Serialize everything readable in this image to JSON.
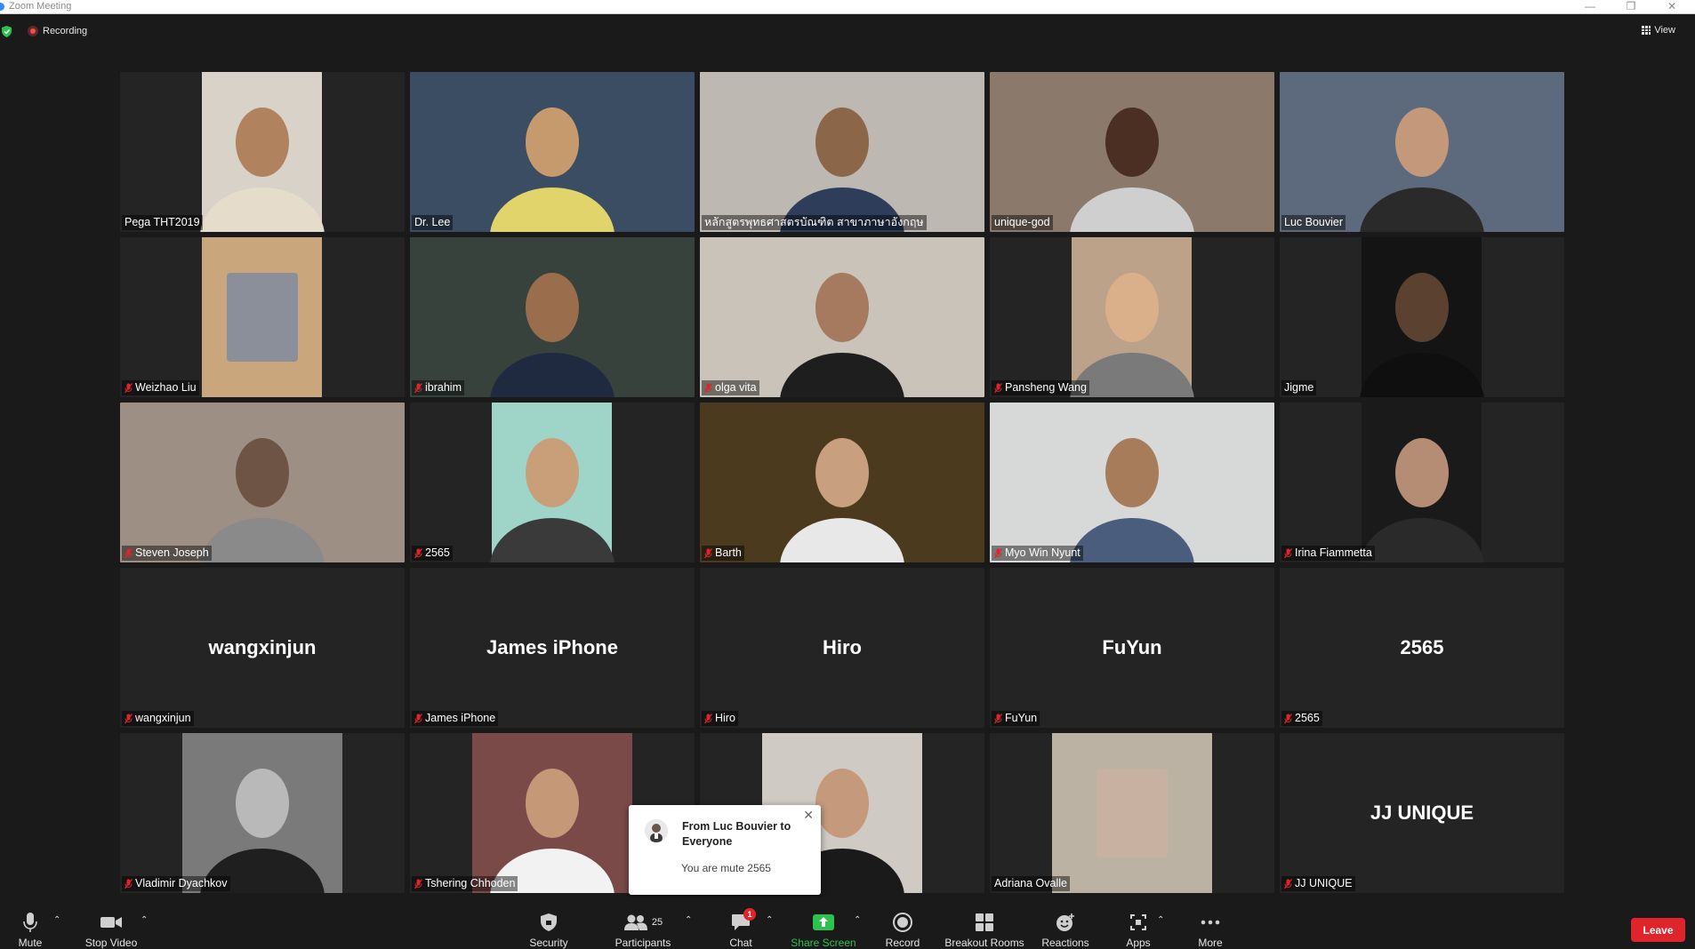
{
  "window": {
    "title": "Zoom Meeting"
  },
  "header": {
    "recording_label": "Recording",
    "view_label": "View"
  },
  "tiles": [
    {
      "name": "Pega THT2019",
      "muted": false
    },
    {
      "name": "Dr. Lee",
      "muted": false
    },
    {
      "name": "หลักสูตรพุทธศาสตรบัณฑิต สาขาภาษาอังกฤษ",
      "muted": false,
      "speaking": true
    },
    {
      "name": "unique-god",
      "muted": false
    },
    {
      "name": "Luc Bouvier",
      "muted": false
    },
    {
      "name": "Weizhao Liu",
      "muted": true
    },
    {
      "name": "ibrahim",
      "muted": true
    },
    {
      "name": "olga vita",
      "muted": true
    },
    {
      "name": "Pansheng Wang",
      "muted": true
    },
    {
      "name": "Jigme",
      "muted": false
    },
    {
      "name": "Steven Joseph",
      "muted": true
    },
    {
      "name": "2565",
      "muted": true
    },
    {
      "name": "Barth",
      "muted": true
    },
    {
      "name": "Myo Win Nyunt",
      "muted": true
    },
    {
      "name": "Irina Fiammetta",
      "muted": true
    },
    {
      "name": "wangxinjun",
      "muted": true,
      "center_name": "wangxinjun"
    },
    {
      "name": "James iPhone",
      "muted": true,
      "center_name": "James iPhone"
    },
    {
      "name": "Hiro",
      "muted": true,
      "center_name": "Hiro"
    },
    {
      "name": "FuYun",
      "muted": true,
      "center_name": "FuYun"
    },
    {
      "name": "2565",
      "muted": true,
      "center_name": "2565"
    },
    {
      "name": "Vladimir Dyachkov",
      "muted": true
    },
    {
      "name": "Tshering Chhoden",
      "muted": true
    },
    {
      "name": "",
      "muted": false
    },
    {
      "name": "Adriana Ovalle",
      "muted": false
    },
    {
      "name": "JJ UNIQUE",
      "muted": true,
      "center_name": "JJ UNIQUE"
    }
  ],
  "chat_popup": {
    "from": "From Luc Bouvier to Everyone",
    "message": "You are mute 2565"
  },
  "toolbar": {
    "mute": "Mute",
    "stop_video": "Stop Video",
    "security": "Security",
    "participants": "Participants",
    "participant_count": "25",
    "chat": "Chat",
    "chat_badge": "1",
    "share_screen": "Share Screen",
    "record": "Record",
    "breakout_rooms": "Breakout Rooms",
    "reactions": "Reactions",
    "apps": "Apps",
    "more": "More",
    "leave": "Leave"
  },
  "colors": {
    "background": "#1a1a1a",
    "tile": "#242424",
    "speaker_outline": "#c6e08a",
    "share_green": "#2dc24f",
    "leave_red": "#e0242b",
    "muted_red": "#e0242b"
  }
}
